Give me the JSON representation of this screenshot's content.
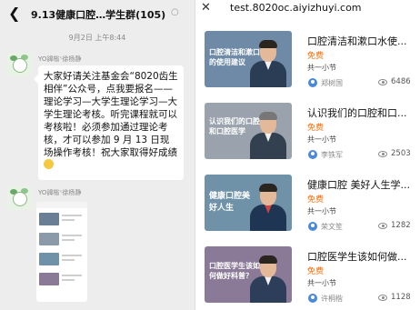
{
  "chat": {
    "title": "9.13健康口腔…学生群(105)",
    "timestamp": "9月2日 上午8:44",
    "messages": [
      {
        "sender": "YO䜰㮐ᐠ徐杨静",
        "text": "大家好请关注基金会“8020齿生相伴”公众号，点我要报名——理论学习—大学生理论学习—大学生理论考核。听完课程就可以考核啦！必须参加通过理论考核，才可以参加 9 月 13 日现场操作考核！祝大家取得好成绩"
      },
      {
        "sender": "YO䜰㮐ᐠ徐杨静",
        "type": "image"
      }
    ]
  },
  "course": {
    "url": "test.8020oc.aiyizhuyi.com",
    "items": [
      {
        "cover_text": "口腔清洁和漱口水的使用建议",
        "cover_color": "#6e8aa6",
        "title": "口腔清洁和漱口水使...",
        "price": "免费",
        "lessons": "共一小节",
        "tutor": "郑树国",
        "views": "6486"
      },
      {
        "cover_text": "认识我们的口腔和口腔医学",
        "cover_color": "#9aa3ad",
        "title": "认识我们的口腔和口...",
        "price": "免费",
        "lessons": "共一小节",
        "tutor": "李铁军",
        "views": "2503"
      },
      {
        "cover_text": "健康口腔美好人生",
        "cover_color": "#6f92a8",
        "title": "健康口腔 美好人生学...",
        "price": "免费",
        "lessons": "共一小节",
        "tutor": "荣文笙",
        "views": "1282"
      },
      {
        "cover_text": "口腔医学生该如何做好科普？",
        "cover_color": "#8a7a98",
        "title": "口腔医学生该如何做...",
        "price": "免费",
        "lessons": "共一小节",
        "tutor": "许桐楷",
        "views": "1128"
      }
    ]
  }
}
